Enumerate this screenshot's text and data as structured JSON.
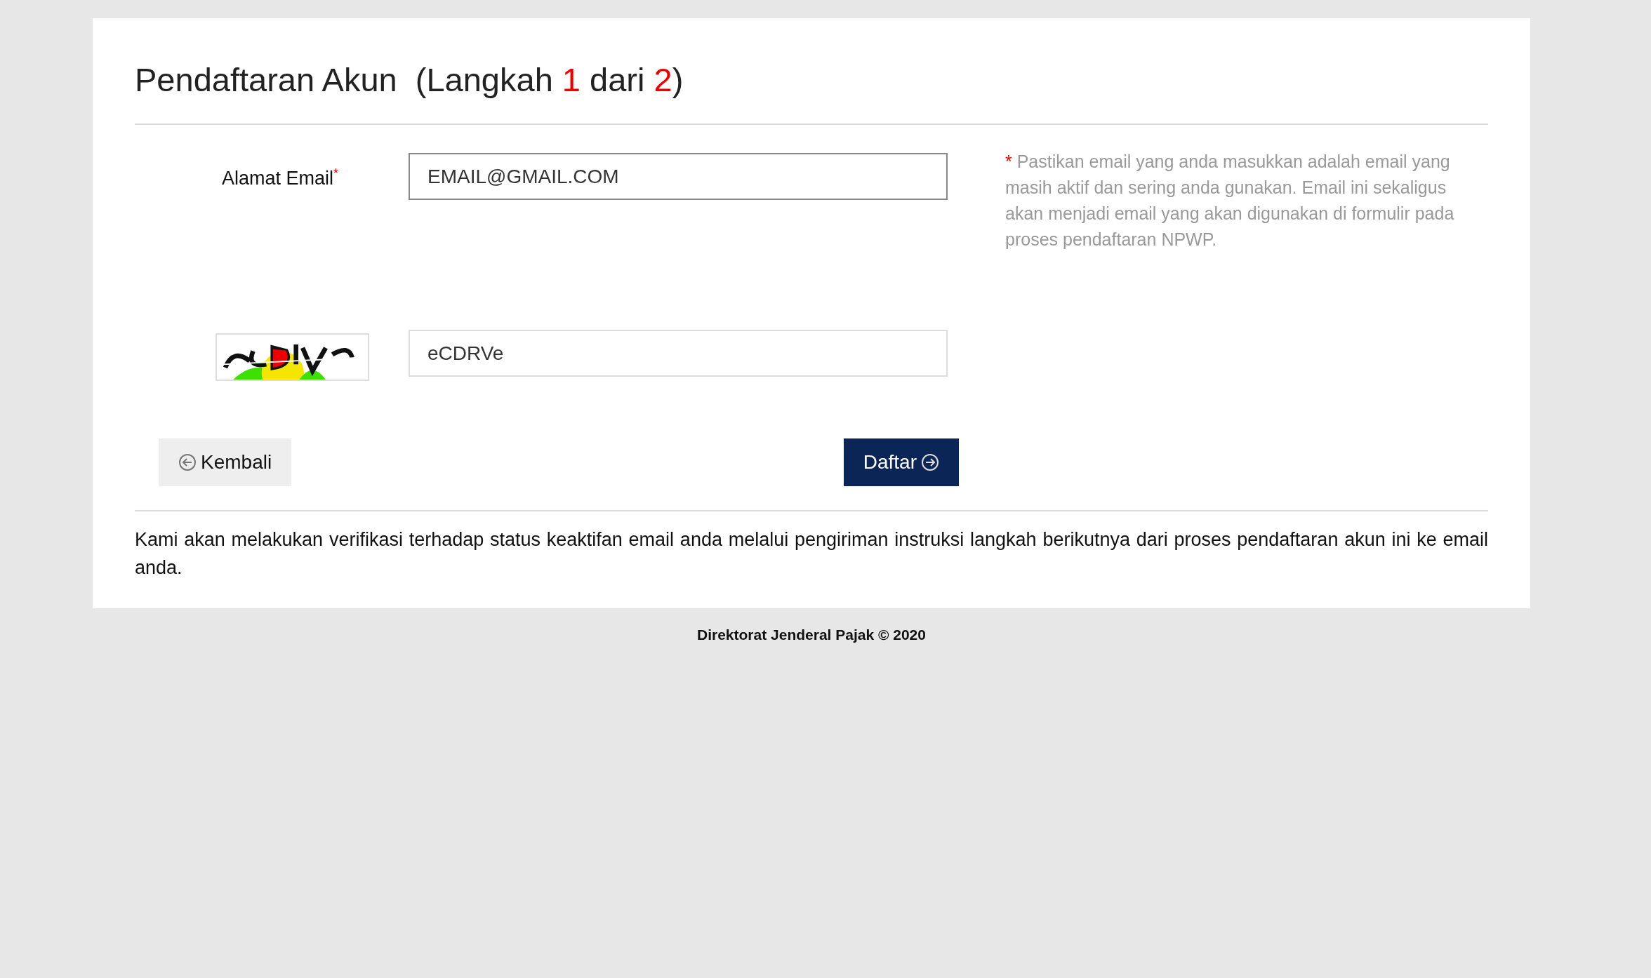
{
  "title": {
    "parts": [
      {
        "kind": "plain",
        "text": "Pendaftaran Akun  (Langkah "
      },
      {
        "kind": "highlight",
        "text": "1"
      },
      {
        "kind": "plain",
        "text": " dari "
      },
      {
        "kind": "highlight",
        "text": "2"
      },
      {
        "kind": "plain",
        "text": ")"
      }
    ]
  },
  "email": {
    "label": "Alamat Email",
    "required_mark": "*",
    "value": "EMAIL@GMAIL.COM"
  },
  "help": {
    "mark": "*",
    "text": "Pastikan email yang anda masukkan adalah email yang masih aktif dan sering anda gunakan. Email ini sekaligus akan menjadi email yang akan digunakan di formulir pada proses pendaftaran NPWP."
  },
  "captcha": {
    "value": "eCDRVe"
  },
  "buttons": [
    {
      "kind": "back",
      "label": "Kembali"
    },
    {
      "kind": "submit",
      "label": "Daftar"
    }
  ],
  "note": "Kami akan melakukan verifikasi terhadap status keaktifan email anda melalui pengiriman instruksi langkah berikutnya dari proses pendaftaran akun ini ke email anda.",
  "footer": "Direktorat Jenderal Pajak © 2020"
}
